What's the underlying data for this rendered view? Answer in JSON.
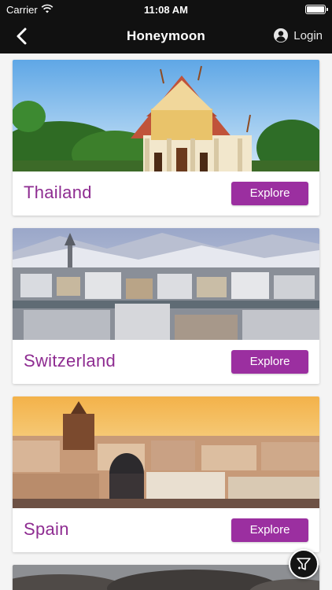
{
  "status_bar": {
    "carrier": "Carrier",
    "time": "11:08 AM"
  },
  "nav": {
    "title": "Honeymoon",
    "login_label": "Login"
  },
  "destinations": [
    {
      "name": "Thailand",
      "button": "Explore"
    },
    {
      "name": "Switzerland",
      "button": "Explore"
    },
    {
      "name": "Spain",
      "button": "Explore"
    }
  ],
  "colors": {
    "accent": "#9b2fa0",
    "name_text": "#8e2c91",
    "bar_background": "#111111"
  },
  "icons": {
    "back": "chevron-left-icon",
    "user": "user-circle-icon",
    "filter": "filter-icon"
  }
}
